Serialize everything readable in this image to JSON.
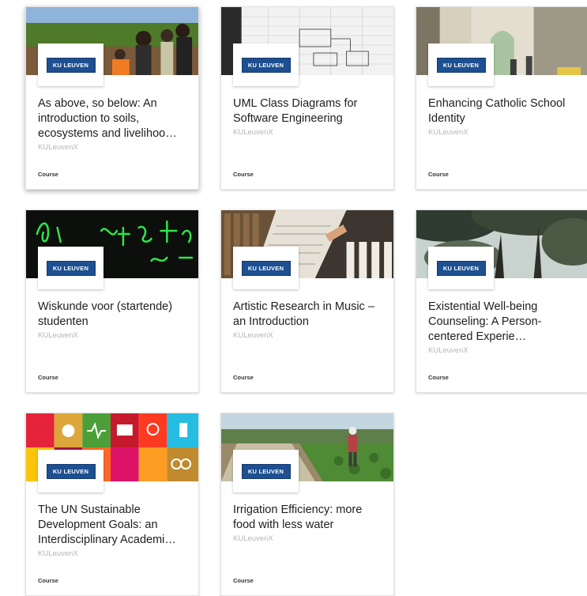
{
  "cards": [
    {
      "title": "As above, so below: An introduction to soils, ecosystems and livelihoo…",
      "org": "KULeuvenX",
      "type": "Course",
      "logo": "KU LEUVEN",
      "image": "people-in-field"
    },
    {
      "title": "UML Class Diagrams for Software Engineering",
      "org": "KULeuvenX",
      "type": "Course",
      "logo": "KU LEUVEN",
      "image": "uml-sketch-on-paper"
    },
    {
      "title": "Enhancing Catholic School Identity",
      "org": "KULeuvenX",
      "type": "Course",
      "logo": "KU LEUVEN",
      "image": "school-corridor"
    },
    {
      "title": "Wiskunde voor (startende) studenten",
      "org": "KULeuvenX",
      "type": "Course",
      "logo": "KU LEUVEN",
      "image": "green-math-blackboard"
    },
    {
      "title": "Artistic Research in Music – an Introduction",
      "org": "KULeuvenX",
      "type": "Course",
      "logo": "KU LEUVEN",
      "image": "library-sheet-music-piano"
    },
    {
      "title": "Existential Well-being Counseling: A Person-centered Experie…",
      "org": "KULeuvenX",
      "type": "Course",
      "logo": "KU LEUVEN",
      "image": "forest-canopy"
    },
    {
      "title": "The UN Sustainable Development Goals: an Interdisciplinary Academi…",
      "org": "KULeuvenX",
      "type": "Course",
      "logo": "KU LEUVEN",
      "image": "sdg-icons"
    },
    {
      "title": "Irrigation Efficiency: more food with less water",
      "org": "KULeuvenX",
      "type": "Course",
      "logo": "KU LEUVEN",
      "image": "farmer-irrigation-field"
    }
  ],
  "colors": {
    "brand": "#1d4f91",
    "title": "#202020",
    "org": "#b5b5b5"
  }
}
